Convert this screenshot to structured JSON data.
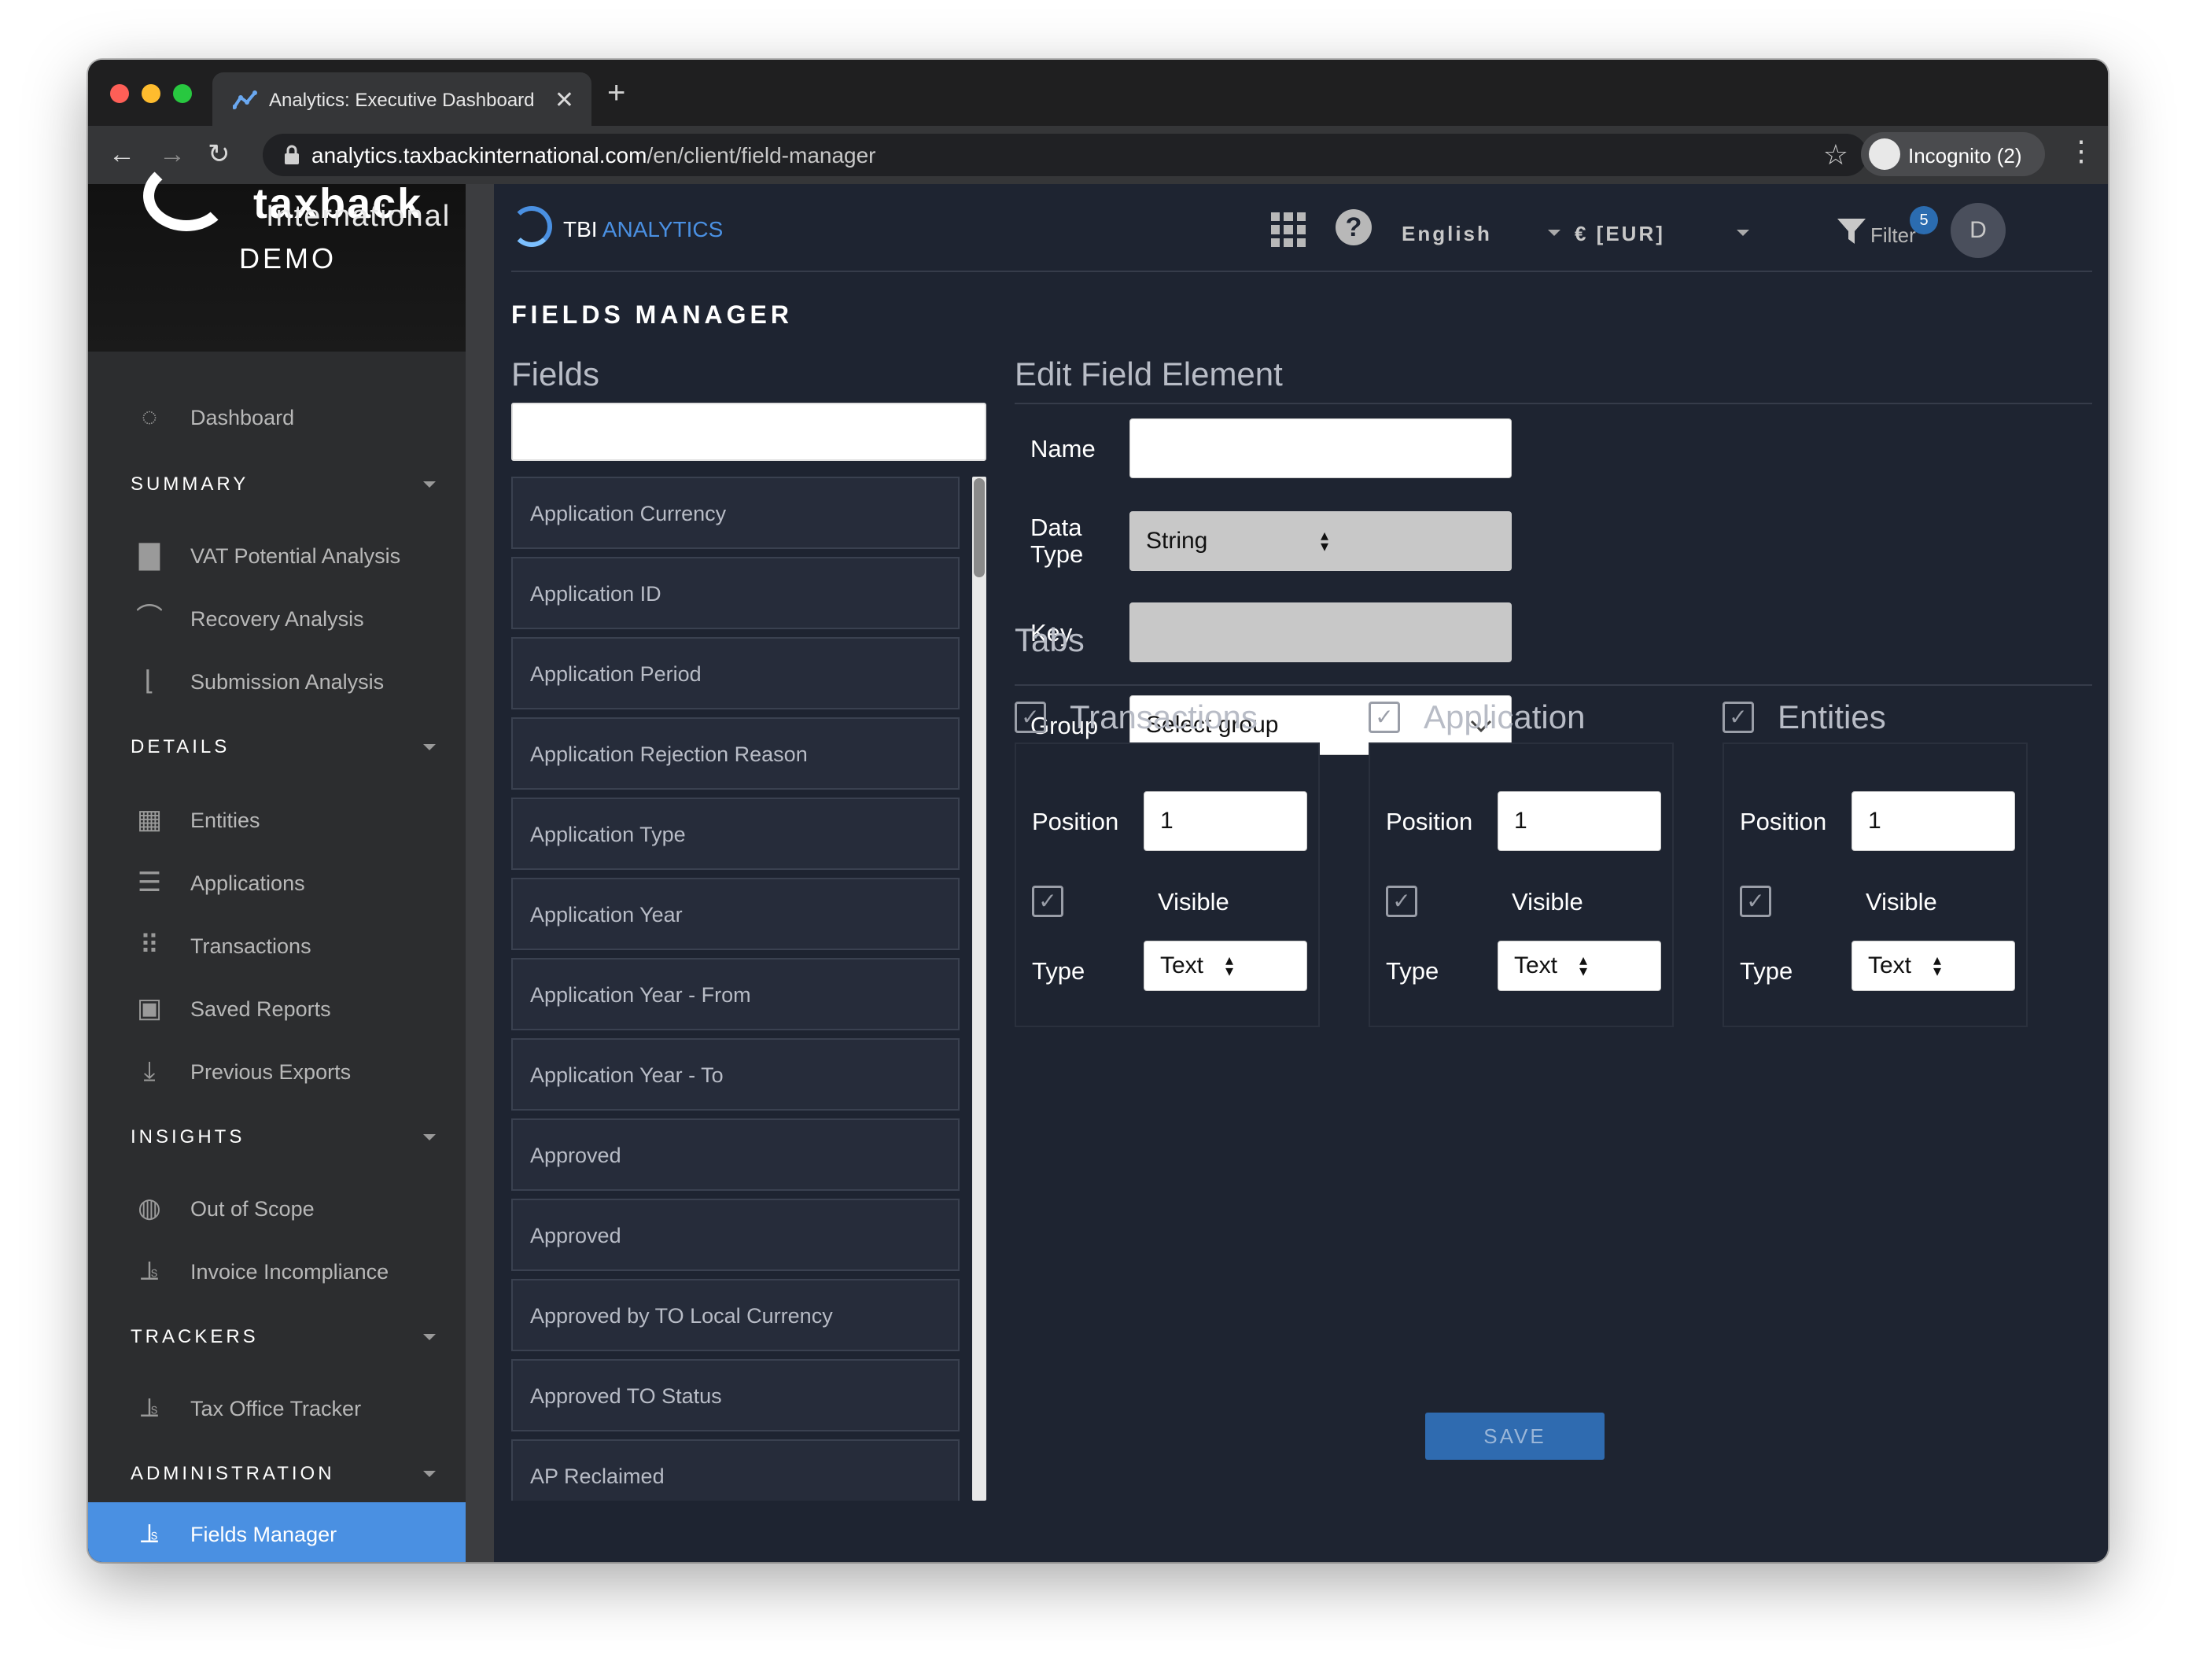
{
  "browser": {
    "tab_title": "Analytics: Executive Dashboard",
    "url_host": "analytics.taxbackinternational.com",
    "url_path": "/en/client/field-manager",
    "profile_label": "Incognito (2)"
  },
  "brand": {
    "name_line1": "taxback",
    "name_line2": "International",
    "demo_label": "DEMO"
  },
  "sidebar": {
    "dashboard": "Dashboard",
    "sections": [
      {
        "title": "SUMMARY",
        "items": [
          "VAT Potential Analysis",
          "Recovery Analysis",
          "Submission Analysis"
        ]
      },
      {
        "title": "DETAILS",
        "items": [
          "Entities",
          "Applications",
          "Transactions",
          "Saved Reports",
          "Previous Exports"
        ]
      },
      {
        "title": "INSIGHTS",
        "items": [
          "Out of Scope",
          "Invoice Incompliance"
        ]
      },
      {
        "title": "TRACKERS",
        "items": [
          "Tax Office Tracker"
        ]
      },
      {
        "title": "ADMINISTRATION",
        "items": [
          "Fields Manager"
        ]
      }
    ],
    "active_item": "Fields Manager"
  },
  "topbar": {
    "logo_prefix": "TBI",
    "logo_suffix": "ANALYTICS",
    "language": "English",
    "currency": "€ [EUR]",
    "filter_label": "Filter",
    "filter_count": "5",
    "avatar_initial": "D"
  },
  "page": {
    "title": "FIELDS MANAGER",
    "fields_header": "Fields",
    "edit_header": "Edit Field Element",
    "tabs_header": "Tabs",
    "save_label": "SAVE"
  },
  "fields_list": [
    "Application Currency",
    "Application ID",
    "Application Period",
    "Application Rejection Reason",
    "Application Type",
    "Application Year",
    "Application Year - From",
    "Application Year - To",
    "Approved",
    "Approved",
    "Approved by TO Local Currency",
    "Approved TO Status",
    "AP Reclaimed"
  ],
  "form": {
    "name_label": "Name",
    "name_value": "",
    "data_type_label_1": "Data",
    "data_type_label_2": "Type",
    "data_type_value": "String",
    "key_label": "Key",
    "key_value": "",
    "group_label": "Group",
    "group_placeholder": "Select group"
  },
  "tabs": [
    {
      "name": "Transactions",
      "checked": true,
      "position_label": "Position",
      "position": "1",
      "visible_label": "Visible",
      "visible": true,
      "type_label": "Type",
      "type": "Text"
    },
    {
      "name": "Application",
      "checked": true,
      "position_label": "Position",
      "position": "1",
      "visible_label": "Visible",
      "visible": true,
      "type_label": "Type",
      "type": "Text"
    },
    {
      "name": "Entities",
      "checked": true,
      "position_label": "Position",
      "position": "1",
      "visible_label": "Visible",
      "visible": true,
      "type_label": "Type",
      "type": "Text"
    }
  ],
  "colors": {
    "accent": "#4a90e2",
    "background": "#1e2431",
    "sidebar": "#2c2d2f",
    "save_button": "#2f6bb0"
  }
}
